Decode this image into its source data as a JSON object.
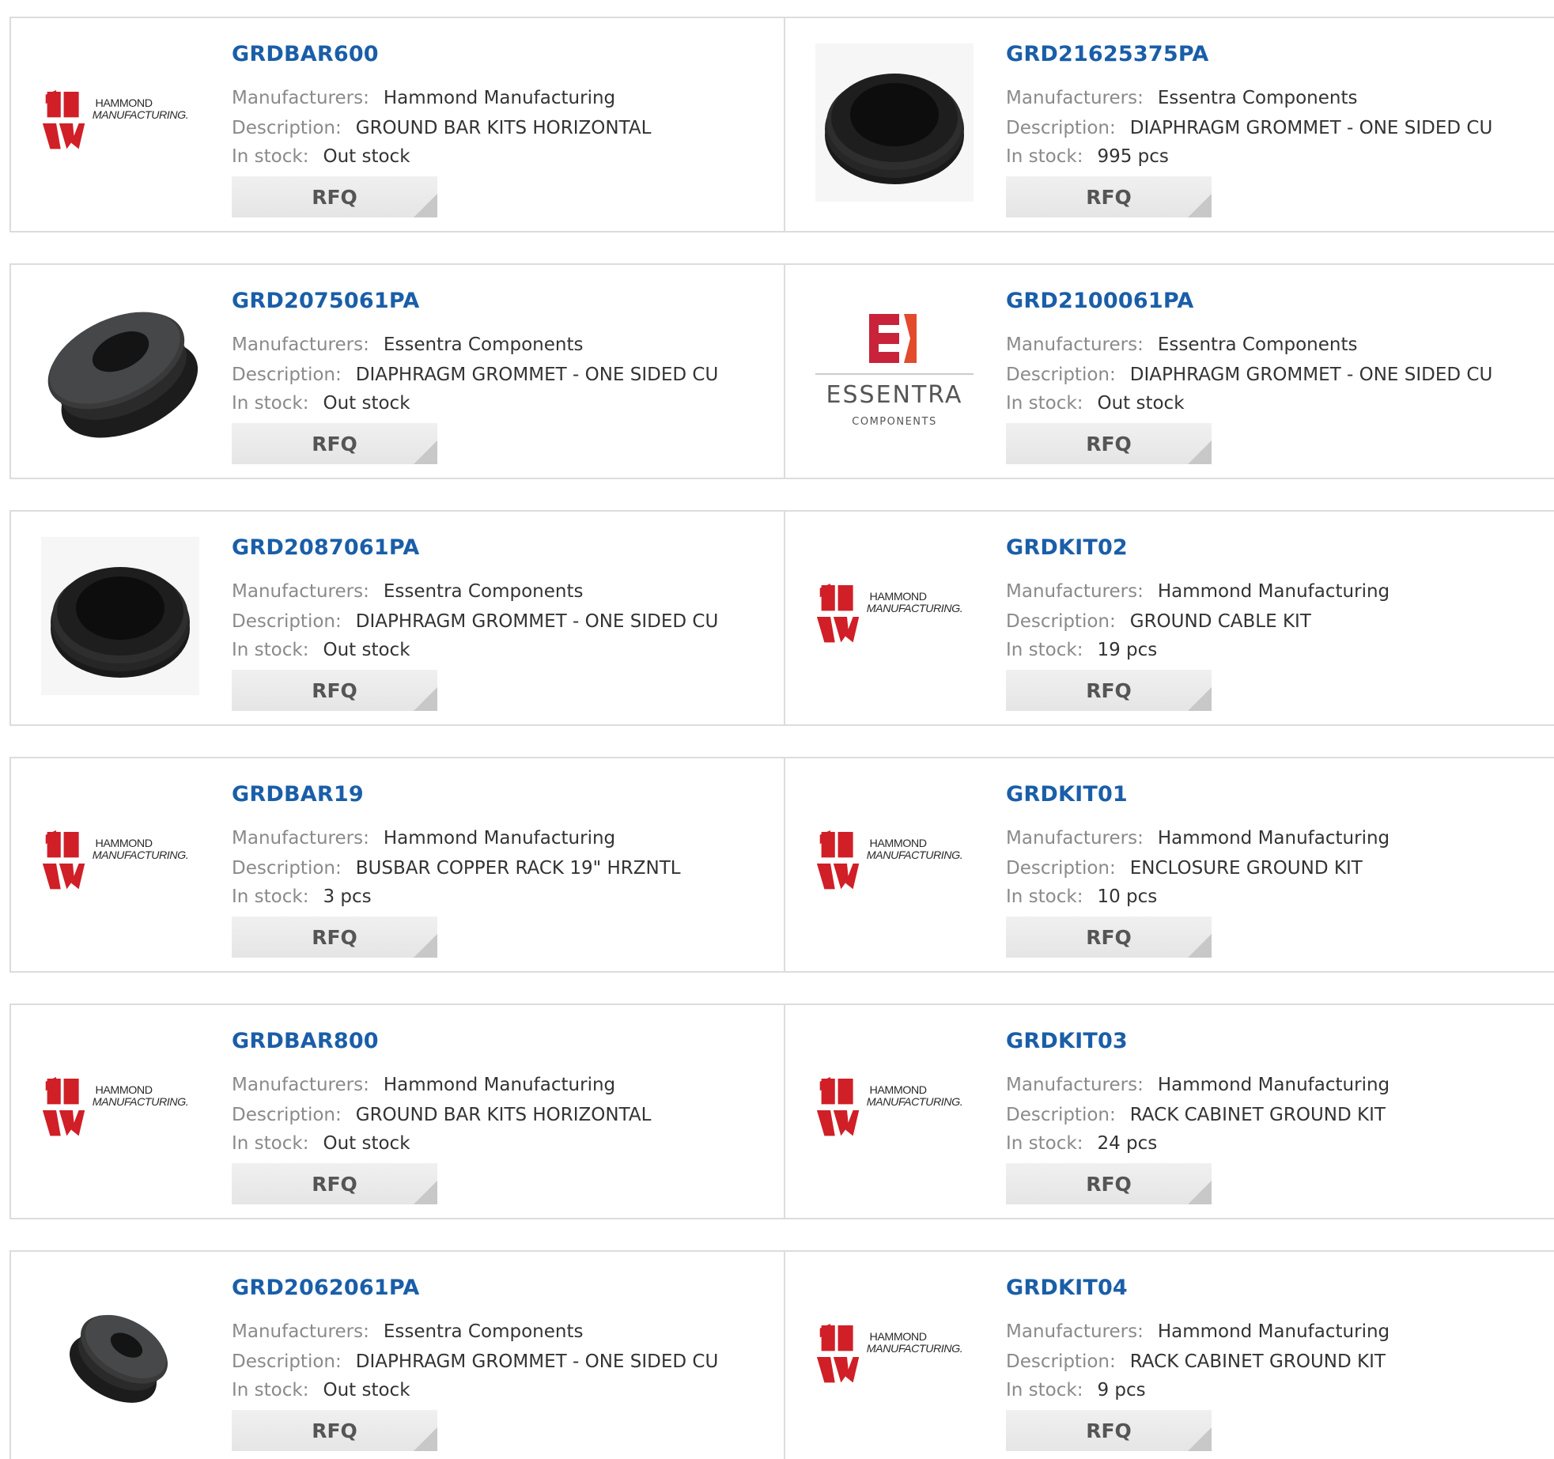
{
  "labels": {
    "manufacturers": "Manufacturers:",
    "description": "Description:",
    "stock": "In stock:",
    "rfq": "RFQ"
  },
  "colors": {
    "part_link": "#1a5ea8",
    "hammond_red": "#d01f27",
    "border": "#dcdcdc"
  },
  "logo_text": {
    "hammond_line1": "HAMMOND",
    "hammond_line2": "MANUFACTURING.",
    "essentra_line1": "ESSENTRA",
    "essentra_line2": "COMPONENTS"
  },
  "products": [
    {
      "part": "GRDBAR600",
      "manufacturer": "Hammond Manufacturing",
      "description": "GROUND BAR KITS HORIZONTAL",
      "stock": "Out stock",
      "image": "hammond-logo"
    },
    {
      "part": "GRD21625375PA",
      "manufacturer": "Essentra Components",
      "description": "DIAPHRAGM GROMMET - ONE SIDED CU",
      "stock": "995 pcs",
      "image": "grommet-front"
    },
    {
      "part": "GRD2075061PA",
      "manufacturer": "Essentra Components",
      "description": "DIAPHRAGM GROMMET - ONE SIDED CU",
      "stock": "Out stock",
      "image": "grommet-angled-large"
    },
    {
      "part": "GRD2100061PA",
      "manufacturer": "Essentra Components",
      "description": "DIAPHRAGM GROMMET - ONE SIDED CU",
      "stock": "Out stock",
      "image": "essentra-logo"
    },
    {
      "part": "GRD2087061PA",
      "manufacturer": "Essentra Components",
      "description": "DIAPHRAGM GROMMET - ONE SIDED CU",
      "stock": "Out stock",
      "image": "grommet-front"
    },
    {
      "part": "GRDKIT02",
      "manufacturer": "Hammond Manufacturing",
      "description": "GROUND CABLE KIT",
      "stock": "19 pcs",
      "image": "hammond-logo"
    },
    {
      "part": "GRDBAR19",
      "manufacturer": "Hammond Manufacturing",
      "description": "BUSBAR COPPER RACK 19\" HRZNTL",
      "stock": "3 pcs",
      "image": "hammond-logo"
    },
    {
      "part": "GRDKIT01",
      "manufacturer": "Hammond Manufacturing",
      "description": "ENCLOSURE GROUND KIT",
      "stock": "10 pcs",
      "image": "hammond-logo"
    },
    {
      "part": "GRDBAR800",
      "manufacturer": "Hammond Manufacturing",
      "description": "GROUND BAR KITS HORIZONTAL",
      "stock": "Out stock",
      "image": "hammond-logo"
    },
    {
      "part": "GRDKIT03",
      "manufacturer": "Hammond Manufacturing",
      "description": "RACK CABINET GROUND KIT",
      "stock": "24 pcs",
      "image": "hammond-logo"
    },
    {
      "part": "GRD2062061PA",
      "manufacturer": "Essentra Components",
      "description": "DIAPHRAGM GROMMET - ONE SIDED CU",
      "stock": "Out stock",
      "image": "grommet-angled-small"
    },
    {
      "part": "GRDKIT04",
      "manufacturer": "Hammond Manufacturing",
      "description": "RACK CABINET GROUND KIT",
      "stock": "9 pcs",
      "image": "hammond-logo"
    }
  ]
}
